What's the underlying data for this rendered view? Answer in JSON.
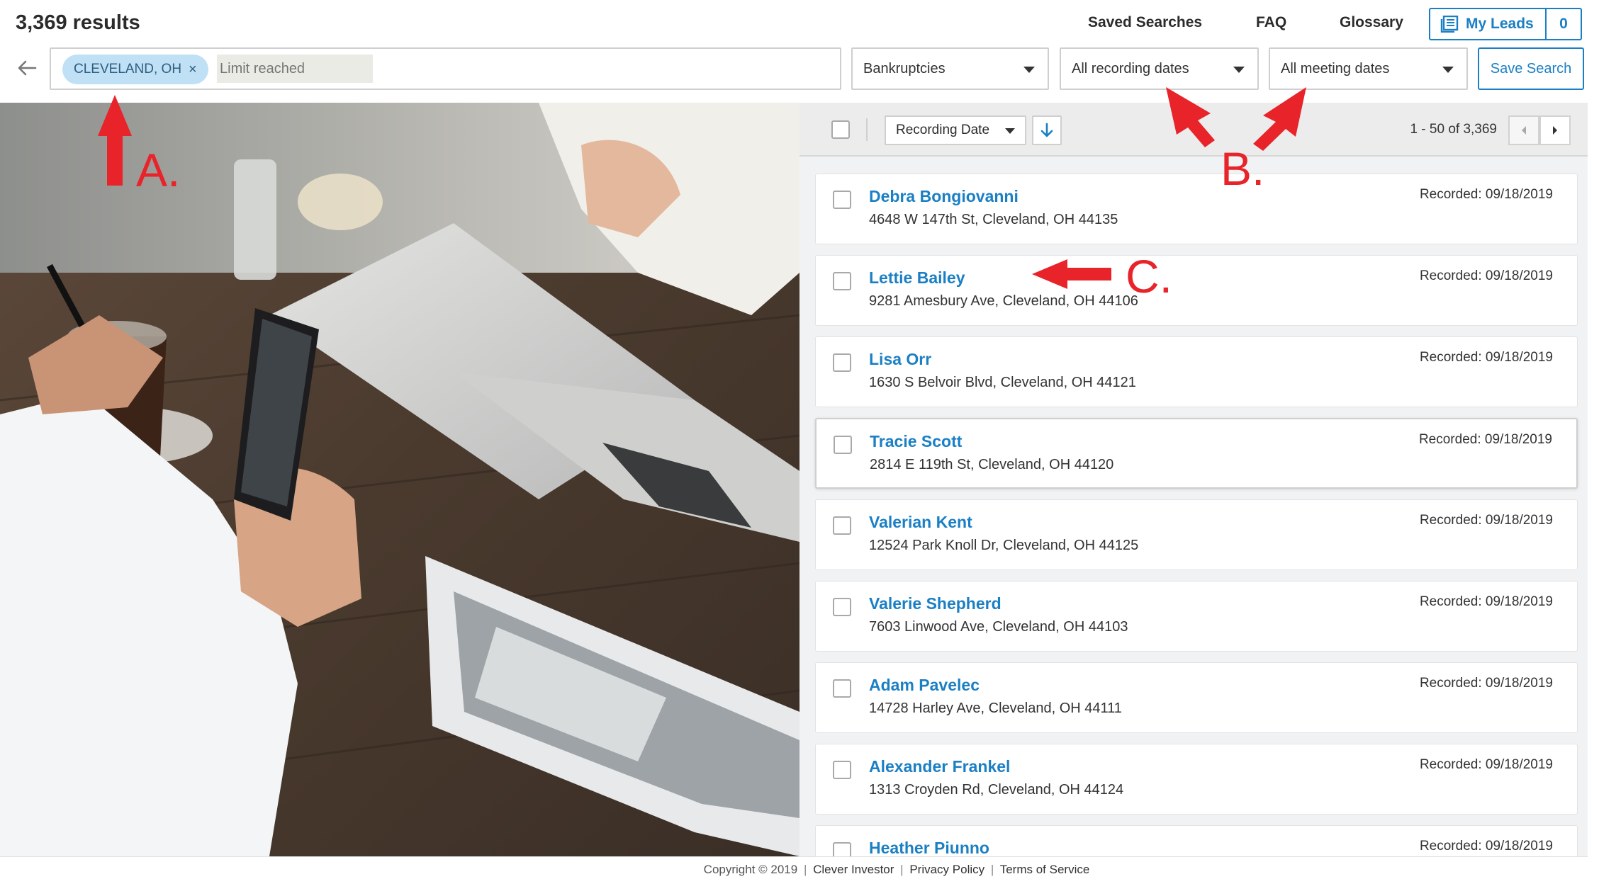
{
  "header": {
    "results_count": "3,369 results",
    "nav": {
      "saved_searches": "Saved Searches",
      "faq": "FAQ",
      "glossary": "Glossary"
    },
    "my_leads": {
      "label": "My Leads",
      "count": "0"
    }
  },
  "search": {
    "chip_label": "CLEVELAND, OH",
    "chip_remove": "×",
    "input_placeholder": "Limit reached",
    "filters": {
      "lead_type": "Bankruptcies",
      "recording_dates": "All recording dates",
      "meeting_dates": "All meeting dates"
    },
    "save_button": "Save Search"
  },
  "results_toolbar": {
    "sort_by": "Recording Date",
    "pagination": "1 - 50 of 3,369"
  },
  "leads": [
    {
      "name": "Debra Bongiovanni",
      "address": "4648 W 147th St, Cleveland, OH 44135",
      "recorded": "Recorded: 09/18/2019"
    },
    {
      "name": "Lettie Bailey",
      "address": "9281 Amesbury Ave, Cleveland, OH 44106",
      "recorded": "Recorded: 09/18/2019"
    },
    {
      "name": "Lisa Orr",
      "address": "1630 S Belvoir Blvd, Cleveland, OH 44121",
      "recorded": "Recorded: 09/18/2019"
    },
    {
      "name": "Tracie Scott",
      "address": "2814 E 119th St, Cleveland, OH 44120",
      "recorded": "Recorded: 09/18/2019"
    },
    {
      "name": "Valerian Kent",
      "address": "12524 Park Knoll Dr, Cleveland, OH 44125",
      "recorded": "Recorded: 09/18/2019"
    },
    {
      "name": "Valerie Shepherd",
      "address": "7603 Linwood Ave, Cleveland, OH 44103",
      "recorded": "Recorded: 09/18/2019"
    },
    {
      "name": "Adam Pavelec",
      "address": "14728 Harley Ave, Cleveland, OH 44111",
      "recorded": "Recorded: 09/18/2019"
    },
    {
      "name": "Alexander Frankel",
      "address": "1313 Croyden Rd, Cleveland, OH 44124",
      "recorded": "Recorded: 09/18/2019"
    },
    {
      "name": "Heather Piunno",
      "address": "",
      "recorded": "Recorded: 09/18/2019"
    }
  ],
  "footer": {
    "copyright": "Copyright © 2019",
    "links": [
      "Clever Investor",
      "Privacy Policy",
      "Terms of Service"
    ],
    "separator": "|"
  },
  "annotations": {
    "a": "A.",
    "b": "B.",
    "c": "C.",
    "color": "#e8232a"
  },
  "colors": {
    "accent": "#1b7fc4",
    "chip_bg": "#bfe0f5",
    "panel_bg": "#f1f2f3"
  }
}
